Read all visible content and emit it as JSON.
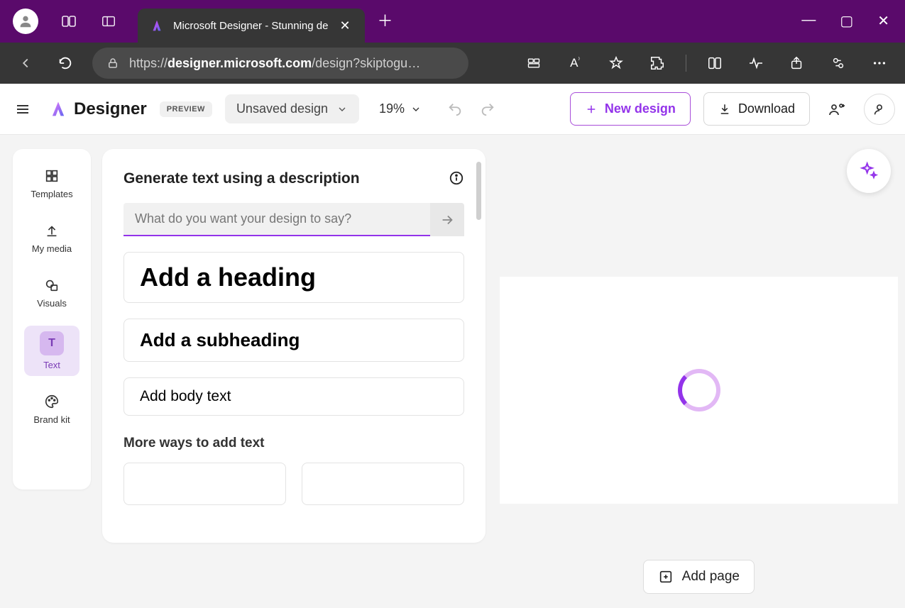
{
  "browser": {
    "tab_title": "Microsoft Designer - Stunning de",
    "url_prefix": "https://",
    "url_host": "designer.microsoft.com",
    "url_path": "/design?skiptogu…",
    "window": {
      "min": "—",
      "max": "▢",
      "close": "✕"
    }
  },
  "header": {
    "app_name": "Designer",
    "badge": "PREVIEW",
    "doc_name": "Unsaved design",
    "zoom": "19%",
    "new_design": "New design",
    "download": "Download"
  },
  "sidebar": {
    "items": [
      {
        "id": "templates",
        "label": "Templates"
      },
      {
        "id": "mymedia",
        "label": "My media"
      },
      {
        "id": "visuals",
        "label": "Visuals"
      },
      {
        "id": "text",
        "label": "Text"
      },
      {
        "id": "brandkit",
        "label": "Brand kit"
      }
    ],
    "active": "text"
  },
  "panel": {
    "title": "Generate text using a description",
    "placeholder": "What do you want your design to say?",
    "heading_option": "Add a heading",
    "subheading_option": "Add a subheading",
    "body_option": "Add body text",
    "more_title": "More ways to add text"
  },
  "footer": {
    "add_page": "Add page"
  }
}
